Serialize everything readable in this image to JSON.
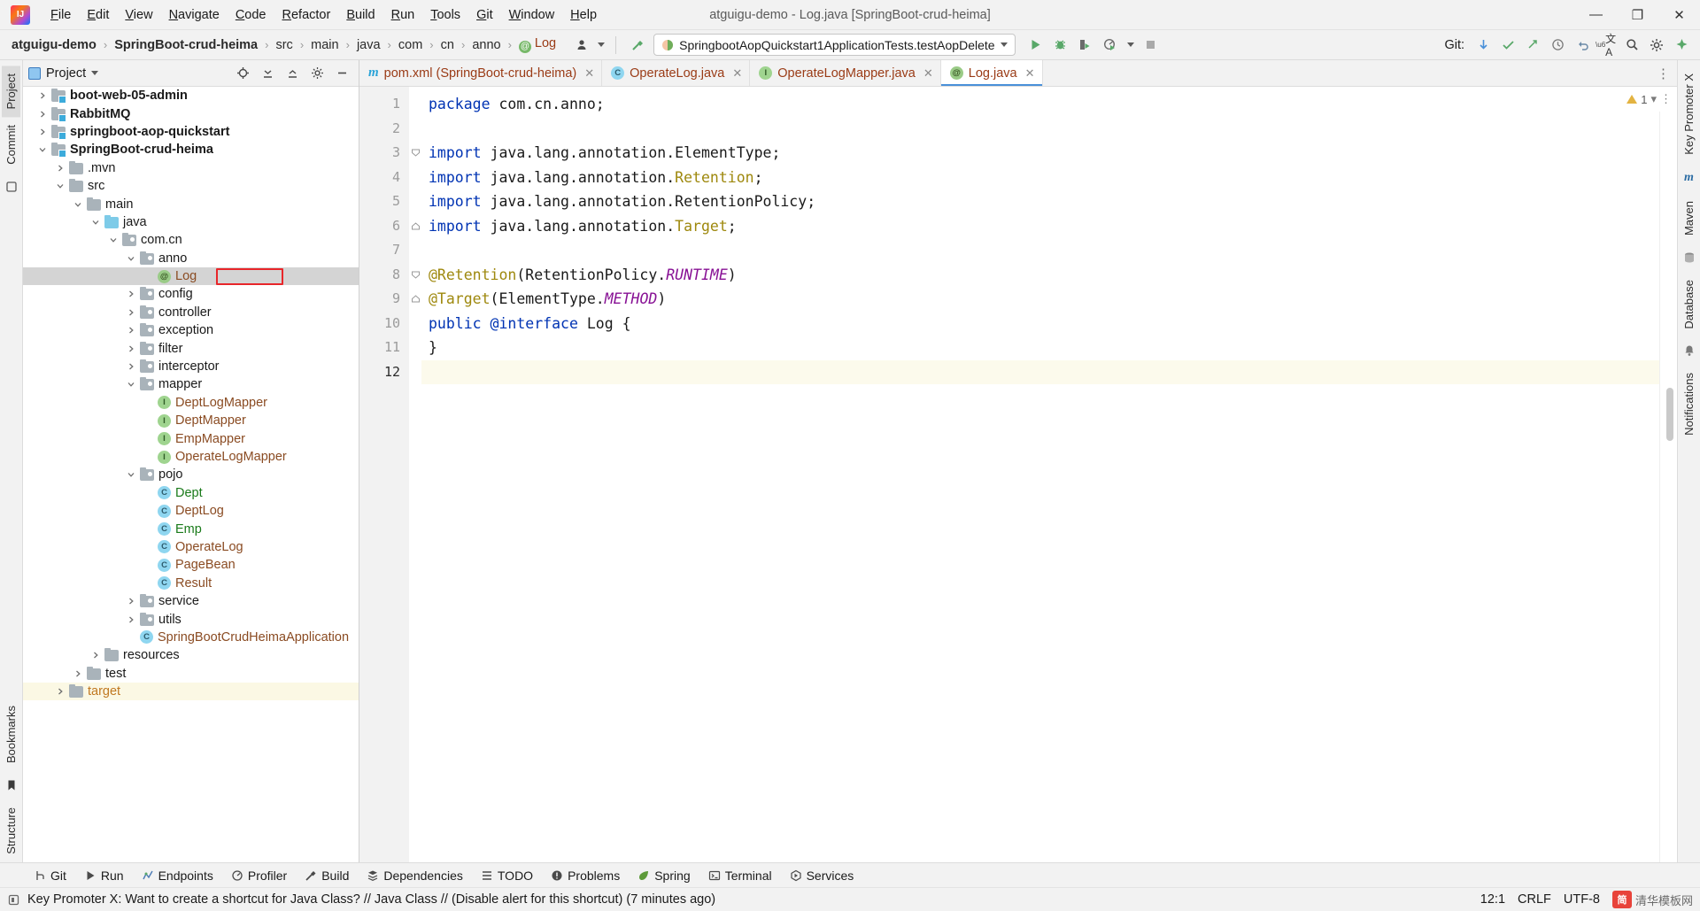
{
  "window": {
    "title": "atguigu-demo - Log.java [SpringBoot-crud-heima]",
    "minimize": "—",
    "maximize": "❐",
    "close": "✕"
  },
  "menubar": {
    "items": [
      {
        "label": "File"
      },
      {
        "label": "Edit"
      },
      {
        "label": "View"
      },
      {
        "label": "Navigate"
      },
      {
        "label": "Code"
      },
      {
        "label": "Refactor"
      },
      {
        "label": "Build"
      },
      {
        "label": "Run"
      },
      {
        "label": "Tools"
      },
      {
        "label": "Git"
      },
      {
        "label": "Window"
      },
      {
        "label": "Help"
      }
    ]
  },
  "breadcrumb": {
    "items": [
      {
        "label": "atguigu-demo",
        "style": "bold"
      },
      {
        "label": "SpringBoot-crud-heima",
        "style": "bold"
      },
      {
        "label": "src",
        "style": "plain"
      },
      {
        "label": "main",
        "style": "plain"
      },
      {
        "label": "java",
        "style": "plain"
      },
      {
        "label": "com",
        "style": "plain"
      },
      {
        "label": "cn",
        "style": "plain"
      },
      {
        "label": "anno",
        "style": "plain"
      },
      {
        "label": "Log",
        "style": "file"
      }
    ],
    "separator": "›"
  },
  "toolbar": {
    "run_configuration": "SpringbootAopQuickstart1ApplicationTests.testAopDelete",
    "run_button": "run-icon",
    "debug_button": "debug-icon",
    "run_coverage_button": "run-with-coverage-icon",
    "profiler_button": "profiler-icon",
    "stop_button": "stop-icon",
    "git_label": "Git:",
    "git_update": "update-project-icon",
    "git_commit": "commit-icon",
    "git_push": "push-icon",
    "history": "history-icon",
    "undo": "undo-icon",
    "translate": "translate-icon",
    "search": "search-everywhere-icon",
    "settings": "settings-icon",
    "ai": "ai-assistant-icon"
  },
  "left_strip": {
    "tabs": [
      {
        "label": "Project",
        "selected": true
      },
      {
        "label": "Commit",
        "selected": false
      },
      {
        "label": "Bookmarks",
        "selected": false
      },
      {
        "label": "Structure",
        "selected": false
      }
    ]
  },
  "right_strip": {
    "tabs": [
      {
        "label": "Key Promoter X"
      },
      {
        "label": "Maven"
      },
      {
        "label": "Database"
      },
      {
        "label": "Notifications"
      }
    ]
  },
  "project_panel": {
    "title": "Project",
    "dropdown": "chevron-down-icon",
    "actions": [
      "locate-icon",
      "expand-all-icon",
      "collapse-all-icon",
      "settings-icon",
      "hide-icon"
    ],
    "tree": [
      {
        "depth": 1,
        "arrow": "right",
        "icon": "module",
        "label": "boot-web-05-admin",
        "color": "plain",
        "bold": true
      },
      {
        "depth": 1,
        "arrow": "right",
        "icon": "module",
        "label": "RabbitMQ",
        "color": "plain",
        "bold": true
      },
      {
        "depth": 1,
        "arrow": "right",
        "icon": "module",
        "label": "springboot-aop-quickstart",
        "color": "plain",
        "bold": true
      },
      {
        "depth": 1,
        "arrow": "down",
        "icon": "module",
        "label": "SpringBoot-crud-heima",
        "color": "plain",
        "bold": true
      },
      {
        "depth": 2,
        "arrow": "right",
        "icon": "folder",
        "label": ".mvn",
        "color": "plain",
        "bold": false
      },
      {
        "depth": 2,
        "arrow": "down",
        "icon": "folder",
        "label": "src",
        "color": "plain",
        "bold": false
      },
      {
        "depth": 3,
        "arrow": "down",
        "icon": "folder",
        "label": "main",
        "color": "plain",
        "bold": false
      },
      {
        "depth": 4,
        "arrow": "down",
        "icon": "src",
        "label": "java",
        "color": "plain",
        "bold": false
      },
      {
        "depth": 5,
        "arrow": "down",
        "icon": "pkg",
        "label": "com.cn",
        "color": "plain",
        "bold": false
      },
      {
        "depth": 6,
        "arrow": "down",
        "icon": "pkg",
        "label": "anno",
        "color": "plain",
        "bold": false
      },
      {
        "depth": 7,
        "arrow": "none",
        "icon": "ann",
        "label": "Log",
        "color": "brown",
        "bold": false,
        "selected": true,
        "highlight": true
      },
      {
        "depth": 6,
        "arrow": "right",
        "icon": "pkg",
        "label": "config",
        "color": "plain",
        "bold": false
      },
      {
        "depth": 6,
        "arrow": "right",
        "icon": "pkg",
        "label": "controller",
        "color": "plain",
        "bold": false
      },
      {
        "depth": 6,
        "arrow": "right",
        "icon": "pkg",
        "label": "exception",
        "color": "plain",
        "bold": false
      },
      {
        "depth": 6,
        "arrow": "right",
        "icon": "pkg",
        "label": "filter",
        "color": "plain",
        "bold": false
      },
      {
        "depth": 6,
        "arrow": "right",
        "icon": "pkg",
        "label": "interceptor",
        "color": "plain",
        "bold": false
      },
      {
        "depth": 6,
        "arrow": "down",
        "icon": "pkg",
        "label": "mapper",
        "color": "plain",
        "bold": false
      },
      {
        "depth": 7,
        "arrow": "none",
        "icon": "int",
        "label": "DeptLogMapper",
        "color": "brown",
        "bold": false
      },
      {
        "depth": 7,
        "arrow": "none",
        "icon": "int",
        "label": "DeptMapper",
        "color": "brown",
        "bold": false
      },
      {
        "depth": 7,
        "arrow": "none",
        "icon": "int",
        "label": "EmpMapper",
        "color": "brown",
        "bold": false
      },
      {
        "depth": 7,
        "arrow": "none",
        "icon": "int",
        "label": "OperateLogMapper",
        "color": "brown",
        "bold": false
      },
      {
        "depth": 6,
        "arrow": "down",
        "icon": "pkg",
        "label": "pojo",
        "color": "plain",
        "bold": false
      },
      {
        "depth": 7,
        "arrow": "none",
        "icon": "cls",
        "label": "Dept",
        "color": "green",
        "bold": false
      },
      {
        "depth": 7,
        "arrow": "none",
        "icon": "cls",
        "label": "DeptLog",
        "color": "brown",
        "bold": false
      },
      {
        "depth": 7,
        "arrow": "none",
        "icon": "cls",
        "label": "Emp",
        "color": "green",
        "bold": false
      },
      {
        "depth": 7,
        "arrow": "none",
        "icon": "cls",
        "label": "OperateLog",
        "color": "brown",
        "bold": false
      },
      {
        "depth": 7,
        "arrow": "none",
        "icon": "cls",
        "label": "PageBean",
        "color": "brown",
        "bold": false
      },
      {
        "depth": 7,
        "arrow": "none",
        "icon": "cls",
        "label": "Result",
        "color": "brown",
        "bold": false
      },
      {
        "depth": 6,
        "arrow": "right",
        "icon": "pkg",
        "label": "service",
        "color": "plain",
        "bold": false
      },
      {
        "depth": 6,
        "arrow": "right",
        "icon": "pkg",
        "label": "utils",
        "color": "plain",
        "bold": false
      },
      {
        "depth": 6,
        "arrow": "none",
        "icon": "cls",
        "label": "SpringBootCrudHeimaApplication",
        "color": "brown",
        "bold": false
      },
      {
        "depth": 4,
        "arrow": "right",
        "icon": "folder",
        "label": "resources",
        "color": "plain",
        "bold": false
      },
      {
        "depth": 3,
        "arrow": "right",
        "icon": "folder",
        "label": "test",
        "color": "plain",
        "bold": false
      },
      {
        "depth": 2,
        "arrow": "right",
        "icon": "folder",
        "label": "target",
        "color": "orange",
        "bold": false,
        "target": true
      }
    ]
  },
  "editor": {
    "tabs": [
      {
        "label": "pom.xml (SpringBoot-crud-heima)",
        "icon": "maven-icon",
        "icon_letter": "m",
        "active": false,
        "closable": true
      },
      {
        "label": "OperateLog.java",
        "icon": "class-icon",
        "icon_letter": "c",
        "active": false,
        "closable": true
      },
      {
        "label": "OperateLogMapper.java",
        "icon": "interface-icon",
        "icon_letter": "I",
        "active": false,
        "closable": true
      },
      {
        "label": "Log.java",
        "icon": "annotation-icon",
        "icon_letter": "@",
        "active": true,
        "closable": true
      }
    ],
    "line_numbers": [
      1,
      2,
      3,
      4,
      5,
      6,
      7,
      8,
      9,
      10,
      11,
      12
    ],
    "current_line": 12,
    "warning_count": "1",
    "lines": [
      {
        "n": 1,
        "tokens": [
          {
            "t": "package ",
            "c": "kw"
          },
          {
            "t": "com.cn.anno;",
            "c": "punct"
          }
        ]
      },
      {
        "n": 2,
        "tokens": []
      },
      {
        "n": 3,
        "tokens": [
          {
            "t": "import ",
            "c": "kw"
          },
          {
            "t": "java.lang.annotation.",
            "c": "punct"
          },
          {
            "t": "ElementType",
            "c": "punct"
          },
          {
            "t": ";",
            "c": "punct"
          }
        ],
        "fold": "start"
      },
      {
        "n": 4,
        "tokens": [
          {
            "t": "import ",
            "c": "kw"
          },
          {
            "t": "java.lang.annotation.",
            "c": "punct"
          },
          {
            "t": "Retention",
            "c": "typ"
          },
          {
            "t": ";",
            "c": "punct"
          }
        ]
      },
      {
        "n": 5,
        "tokens": [
          {
            "t": "import ",
            "c": "kw"
          },
          {
            "t": "java.lang.annotation.",
            "c": "punct"
          },
          {
            "t": "RetentionPolicy",
            "c": "punct"
          },
          {
            "t": ";",
            "c": "punct"
          }
        ]
      },
      {
        "n": 6,
        "tokens": [
          {
            "t": "import ",
            "c": "kw"
          },
          {
            "t": "java.lang.annotation.",
            "c": "punct"
          },
          {
            "t": "Target",
            "c": "typ"
          },
          {
            "t": ";",
            "c": "punct"
          }
        ],
        "fold": "end"
      },
      {
        "n": 7,
        "tokens": []
      },
      {
        "n": 8,
        "tokens": [
          {
            "t": "@Retention",
            "c": "ann"
          },
          {
            "t": "(",
            "c": "punct"
          },
          {
            "t": "RetentionPolicy.",
            "c": "punct"
          },
          {
            "t": "RUNTIME",
            "c": "con"
          },
          {
            "t": ")",
            "c": "punct"
          }
        ],
        "fold": "start"
      },
      {
        "n": 9,
        "tokens": [
          {
            "t": "@Target",
            "c": "ann"
          },
          {
            "t": "(",
            "c": "punct"
          },
          {
            "t": "ElementType.",
            "c": "punct"
          },
          {
            "t": "METHOD",
            "c": "con"
          },
          {
            "t": ")",
            "c": "punct"
          }
        ],
        "fold": "end"
      },
      {
        "n": 10,
        "tokens": [
          {
            "t": "public ",
            "c": "kw"
          },
          {
            "t": "@interface ",
            "c": "kw"
          },
          {
            "t": "Log",
            "c": "punct"
          },
          {
            "t": " {",
            "c": "punct"
          }
        ]
      },
      {
        "n": 11,
        "tokens": [
          {
            "t": "}",
            "c": "punct"
          }
        ]
      },
      {
        "n": 12,
        "tokens": []
      }
    ]
  },
  "tool_windows": {
    "items": [
      {
        "label": "Git",
        "icon": "git-branch-icon"
      },
      {
        "label": "Run",
        "icon": "run-icon"
      },
      {
        "label": "Endpoints",
        "icon": "endpoints-icon"
      },
      {
        "label": "Profiler",
        "icon": "profiler-icon"
      },
      {
        "label": "Build",
        "icon": "build-hammer-icon"
      },
      {
        "label": "Dependencies",
        "icon": "dependencies-icon"
      },
      {
        "label": "TODO",
        "icon": "todo-icon"
      },
      {
        "label": "Problems",
        "icon": "problems-icon"
      },
      {
        "label": "Spring",
        "icon": "spring-leaf-icon"
      },
      {
        "label": "Terminal",
        "icon": "terminal-icon"
      },
      {
        "label": "Services",
        "icon": "services-icon"
      }
    ]
  },
  "statusbar": {
    "message": "Key Promoter X: Want to create a shortcut for Java Class? // Java Class // (Disable alert for this shortcut) (7 minutes ago)",
    "message_icon": "notification-icon",
    "caret_position": "12:1",
    "line_separator": "CRLF",
    "encoding": "UTF-8",
    "watermark_badge": "简",
    "watermark_text": "清华模板网"
  },
  "colors": {
    "accent": "#4a90d9",
    "selection": "#d4d4d4",
    "highlight_outline": "#e8262a",
    "keyword": "#0033b3",
    "annotation": "#9e880d",
    "constant": "#871094",
    "brown_file": "#8a4b22",
    "green_file": "#1a7a1a",
    "caret_row": "#fcfaec"
  }
}
